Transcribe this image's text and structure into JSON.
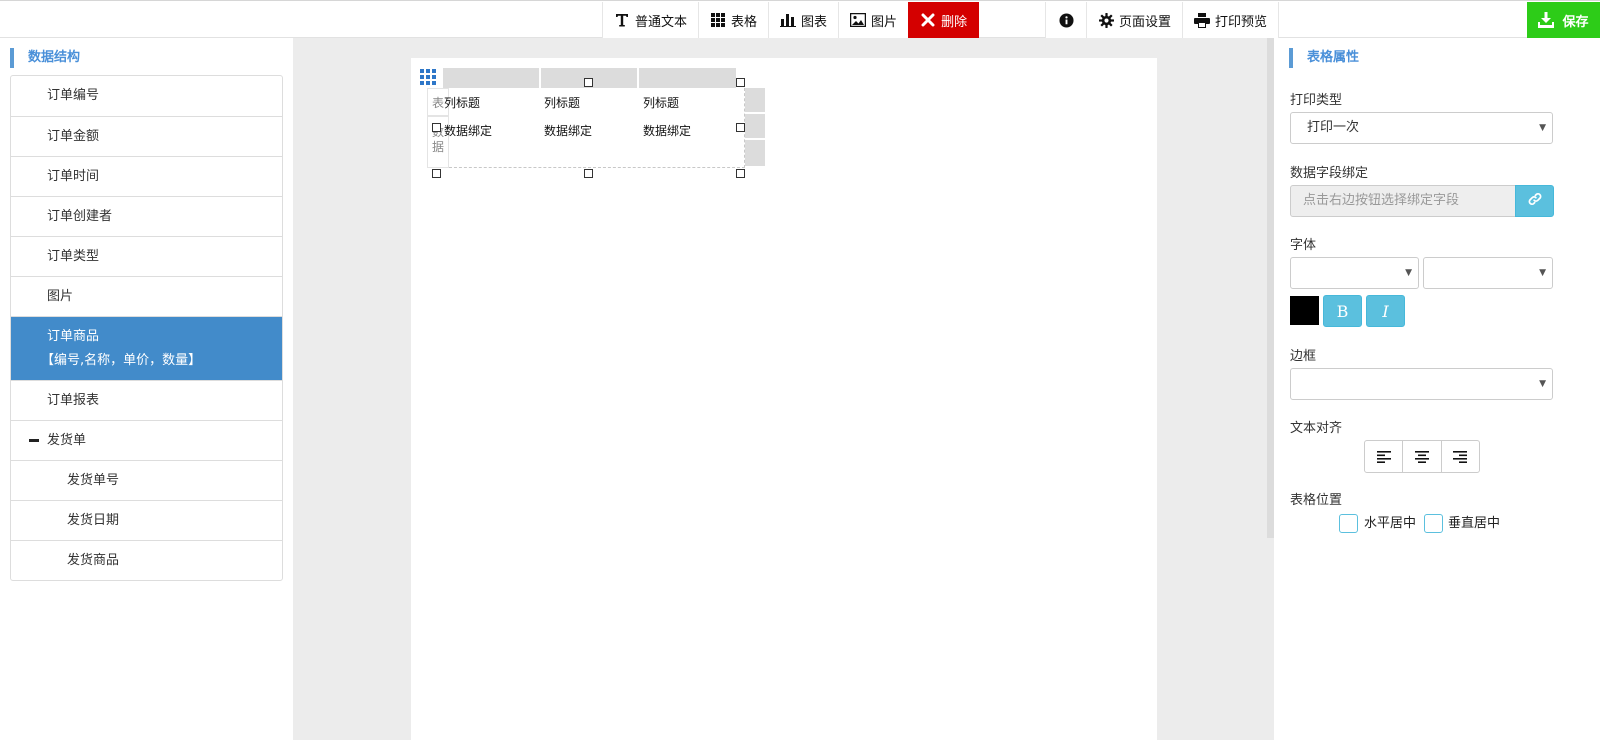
{
  "toolbar": {
    "items": [
      {
        "label": "普通文本",
        "icon": "text-icon"
      },
      {
        "label": "表格",
        "icon": "grid-icon"
      },
      {
        "label": "图表",
        "icon": "bar-chart-icon"
      },
      {
        "label": "图片",
        "icon": "image-icon"
      },
      {
        "label": "删除",
        "icon": "close-icon"
      }
    ],
    "info_icon": "info-icon",
    "page_setup": "页面设置",
    "print_preview": "打印预览",
    "save": "保存",
    "delete_color": "#d40000",
    "save_color": "#2dcc18"
  },
  "left": {
    "title": "数据结构",
    "items": [
      "订单编号",
      "订单金额",
      "订单时间",
      "订单创建者",
      "订单类型",
      "图片"
    ],
    "active_line1": "订单商品",
    "active_line2": "【编号,名称，单价，数量】",
    "after_active": "订单报表",
    "group": "发货单",
    "group_children": [
      "发货单号",
      "发货日期",
      "发货商品"
    ],
    "active_color": "#428bca"
  },
  "table_widget": {
    "row_label_header": "表",
    "row_label_data": "数据",
    "col_title": "列标题",
    "data_binding": "数据绑定"
  },
  "right": {
    "title": "表格属性",
    "print_type_label": "打印类型",
    "print_type_value": "打印一次",
    "data_field_label": "数据字段绑定",
    "data_field_placeholder": "点击右边按钮选择绑定字段",
    "font_label": "字体",
    "bold": "B",
    "italic": "I",
    "font_color": "#000000",
    "border_label": "边框",
    "text_align_label": "文本对齐",
    "table_position_label": "表格位置",
    "h_center": "水平居中",
    "v_center": "垂直居中",
    "accent_color": "#5bc0de"
  }
}
